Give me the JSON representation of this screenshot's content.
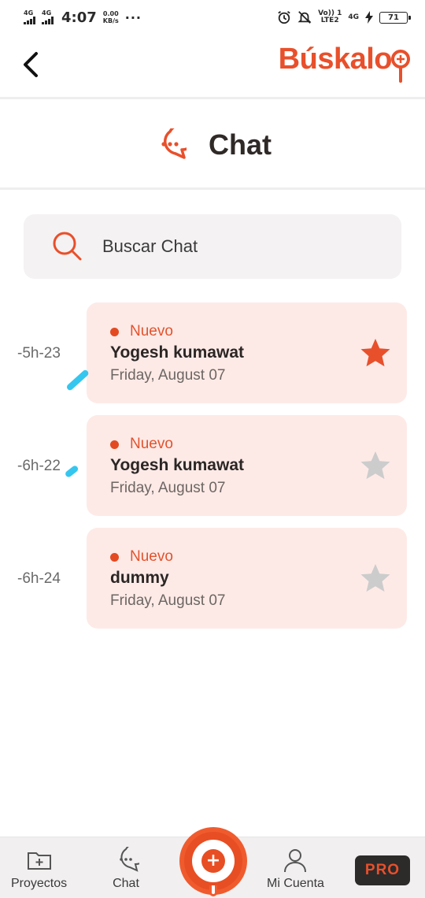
{
  "status_bar": {
    "network_1": "4G",
    "network_2": "4G",
    "time": "4:07",
    "speed_value": "0.00",
    "speed_unit": "KB/s",
    "overflow": "...",
    "volte_top": "Vo)) 1",
    "volte_bottom": "LTE2",
    "network_3": "4G",
    "battery": "71"
  },
  "header": {
    "logo": "Búskalo",
    "page_title": "Chat"
  },
  "search": {
    "placeholder": "Buscar Chat"
  },
  "chats": [
    {
      "time": "-5h-23",
      "badge": "Nuevo",
      "name": "Yogesh kumawat",
      "date": "Friday, August 07",
      "starred": true
    },
    {
      "time": "-6h-22",
      "badge": "Nuevo",
      "name": "Yogesh kumawat",
      "date": "Friday, August 07",
      "starred": false
    },
    {
      "time": "-6h-24",
      "badge": "Nuevo",
      "name": "dummy",
      "date": "Friday, August 07",
      "starred": false
    }
  ],
  "bottom_nav": {
    "projects_label": "Proyectos",
    "chat_label": "Chat",
    "account_label": "Mi Cuenta",
    "pro_label": "PRO",
    "add_symbol": "+"
  },
  "colors": {
    "brand": "#e8502b",
    "card_bg": "#fdeae7",
    "star_active": "#e8502b",
    "star_inactive": "#c9c9c9"
  }
}
